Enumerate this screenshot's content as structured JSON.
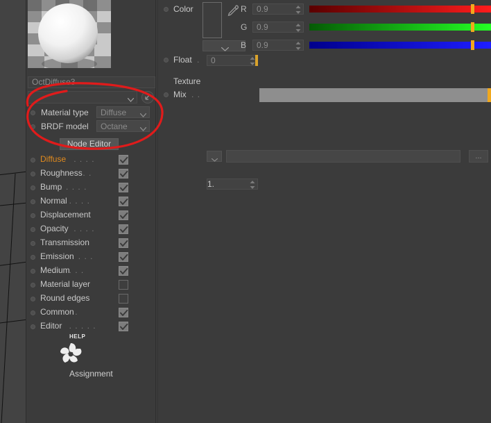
{
  "app": {
    "theme_bg": "#3b3b3b",
    "accent": "#e08a1e",
    "annotation_color": "#e01b1b"
  },
  "preview": {
    "name": "preview-sphere"
  },
  "material": {
    "name_value": "OctDiffuse3",
    "combo_value": "",
    "rows": [
      {
        "label": "Material type",
        "value": "Diffuse"
      },
      {
        "label": "BRDF model",
        "value": "Octane"
      }
    ],
    "node_editor_label": "Node Editor"
  },
  "channels": [
    {
      "label": "Diffuse",
      "dots": ". . . .",
      "checked": true,
      "selected": true
    },
    {
      "label": "Roughness",
      "dots": ". .",
      "checked": true,
      "selected": false
    },
    {
      "label": "Bump",
      "dots": ". . . . .",
      "checked": true,
      "selected": false
    },
    {
      "label": "Normal",
      "dots": ". . . .",
      "checked": true,
      "selected": false
    },
    {
      "label": "Displacement",
      "dots": "",
      "checked": true,
      "selected": false
    },
    {
      "label": "Opacity",
      "dots": ". . . .",
      "checked": true,
      "selected": false
    },
    {
      "label": "Transmission",
      "dots": "",
      "checked": true,
      "selected": false
    },
    {
      "label": "Emission",
      "dots": ". . .",
      "checked": true,
      "selected": false
    },
    {
      "label": "Medium",
      "dots": ". . .",
      "checked": true,
      "selected": false
    },
    {
      "label": "Material layer",
      "dots": "",
      "checked": false,
      "selected": false
    },
    {
      "label": "Round edges",
      "dots": "",
      "checked": false,
      "selected": false
    },
    {
      "label": "Common",
      "dots": ". .",
      "checked": true,
      "selected": false
    },
    {
      "label": "Editor",
      "dots": ". . . . .",
      "checked": true,
      "selected": false
    }
  ],
  "help": {
    "word": "HELP",
    "icon": "octane-pinwheel-icon"
  },
  "assignment_label": "Assignment",
  "properties": {
    "color": {
      "label": "Color",
      "dots": "",
      "swatch_color": "#3d3d3d",
      "mode_value": "",
      "components": [
        {
          "letter": "R",
          "value": "0.9",
          "slider_pct": 90
        },
        {
          "letter": "G",
          "value": "0.9",
          "slider_pct": 90
        },
        {
          "letter": "B",
          "value": "0.9",
          "slider_pct": 90
        }
      ]
    },
    "float": {
      "label": "Float",
      "dots": ".",
      "value": "0",
      "slider_pct": 0
    },
    "texture": {
      "label": "Texture",
      "combo_value": "",
      "field_value": "",
      "browse_label": "..."
    },
    "mix": {
      "label": "Mix",
      "dots": ". .",
      "value": "1.",
      "slider_pct": 100
    }
  }
}
